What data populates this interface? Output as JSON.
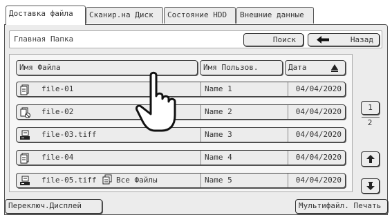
{
  "tabs": [
    {
      "label": "Доставка файла",
      "active": true
    },
    {
      "label": "Сканир.на Диск",
      "active": false
    },
    {
      "label": "Состояние HDD",
      "active": false
    },
    {
      "label": "Внешние данные",
      "active": false
    }
  ],
  "folder": {
    "title": "Главная Папка",
    "search_label": "Поиск",
    "back_label": "Назад"
  },
  "columns": {
    "file_name": "Имя Файла",
    "user_name": "Имя Пользов.",
    "date": "Дата"
  },
  "files": [
    {
      "icon": "print-job-icon",
      "name": "file-01",
      "user": "Name 1",
      "date": "04/04/2020"
    },
    {
      "icon": "print-job-restricted-icon",
      "name": "file-02",
      "user": "Name 2",
      "date": "04/04/2020"
    },
    {
      "icon": "scan-job-icon",
      "name": "file-03.tiff",
      "user": "Name 3",
      "date": "04/04/2020"
    },
    {
      "icon": "print-job-icon",
      "name": "file-04",
      "user": "Name 4",
      "date": "04/04/2020"
    },
    {
      "icon": "scan-job-icon",
      "name": "file-05.tiff",
      "user": "Name 5",
      "date": "04/04/2020"
    }
  ],
  "pagination": {
    "current": "1",
    "total": "2"
  },
  "bottom": {
    "switch_display_label": "Переключ.Дисплей",
    "display_mode_label": "Все Файлы",
    "multi_print_label": "Мультифайл. Печать"
  },
  "colors": {
    "panel": "#ececec",
    "border": "#555555",
    "text": "#333333"
  }
}
